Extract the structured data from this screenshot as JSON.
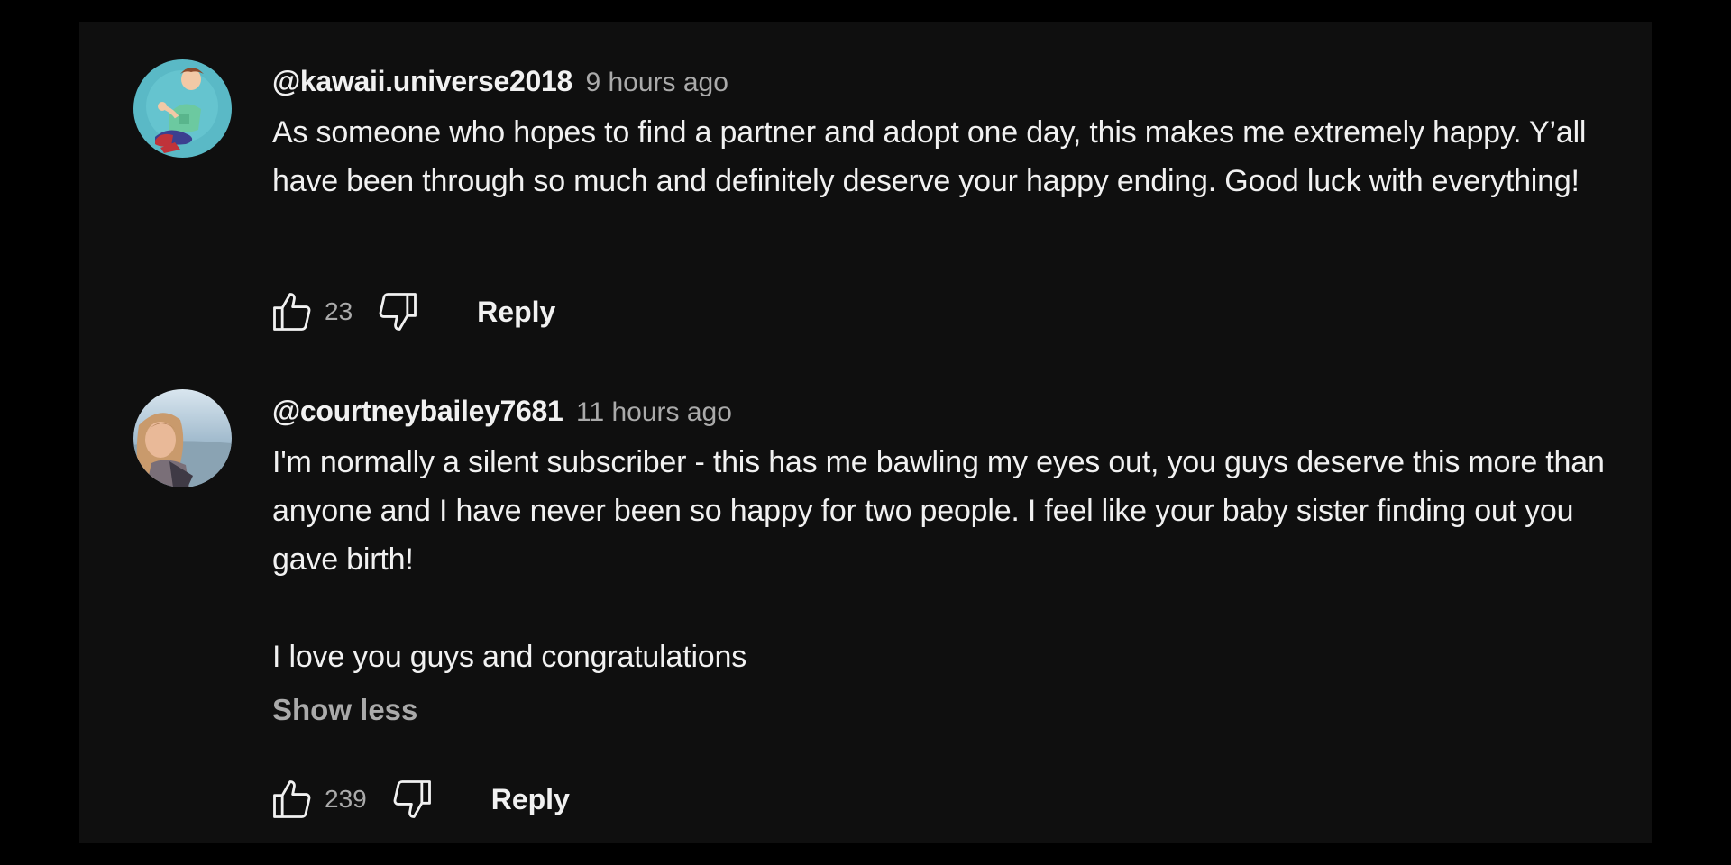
{
  "comments": [
    {
      "handle": "@kawaii.universe2018",
      "time": "9 hours ago",
      "paragraphs": [
        "As someone who hopes to find a partner and adopt one day, this makes me extremely happy. Y’all have been through so much and definitely deserve your happy ending. Good luck with everything!"
      ],
      "likes": "23",
      "reply_label": "Reply",
      "avatar": "cartoon-character-avatar"
    },
    {
      "handle": "@courtneybailey7681",
      "time": "11 hours ago",
      "paragraphs": [
        "I'm normally a silent subscriber - this has me bawling my eyes out, you guys deserve this more than anyone and I have never been so happy for two people. I feel like your baby sister finding out you gave birth!",
        "I love you guys and congratulations"
      ],
      "show_less_label": "Show less",
      "likes": "239",
      "reply_label": "Reply",
      "avatar": "beach-photo-avatar"
    }
  ],
  "icons": {
    "like": "thumbs-up-icon",
    "dislike": "thumbs-down-icon"
  },
  "colors": {
    "background": "#0f0f0f",
    "text_primary": "#f1f1f1",
    "text_secondary": "#aaaaaa"
  }
}
